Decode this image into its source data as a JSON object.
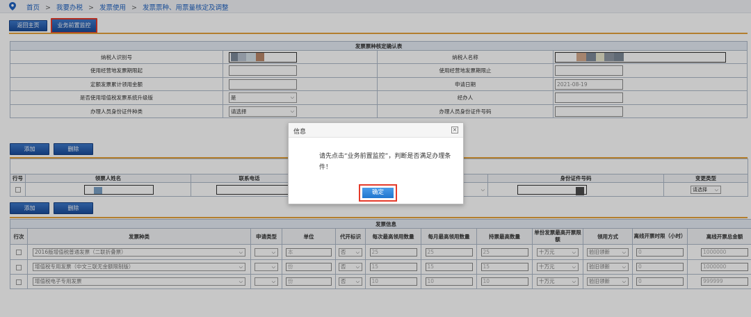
{
  "breadcrumb": {
    "items": [
      "首页",
      "我要办税",
      "发票使用",
      "发票票种、用票量核定及调整"
    ],
    "separator": ">"
  },
  "toolbar": {
    "back_label": "返回主页",
    "precheck_label": "业务前置监控"
  },
  "confirm_table": {
    "title": "发票票种核定确认表",
    "rows": [
      {
        "left_label": "纳税人识别号",
        "right_label": "纳税人名称"
      },
      {
        "left_label": "使用经营地发票期限起",
        "right_label": "使用经营地发票期限止"
      },
      {
        "left_label": "定额发票累计领用金额",
        "right_label": "申请日期",
        "right_value": "2021-08-19"
      },
      {
        "left_label": "是否使用增值税发票系统升级版",
        "left_value": "是",
        "right_label": "经办人"
      },
      {
        "left_label": "办理人员身份证件种类",
        "left_value": "请选择",
        "right_label": "办理人员身份证件号码"
      }
    ]
  },
  "ticket_section": {
    "add_label": "添加",
    "delete_label": "删除",
    "columns": [
      "行号",
      "领票人姓名",
      "联系电话",
      "身份证件号码",
      "变更类型"
    ],
    "change_type_value": "请选择"
  },
  "invoice_section": {
    "add_label": "添加",
    "delete_label": "删除",
    "title": "发票信息",
    "columns": [
      "行次",
      "发票种类",
      "申请类型",
      "单位",
      "代开标识",
      "每次最高领用数量",
      "每月最高领用数量",
      "持票最高数量",
      "单份发票最高开票限额",
      "领用方式",
      "离线开票时限（小时）",
      "离线开票总金额"
    ],
    "rows": [
      {
        "type": "2016版增值税普通发票（二联折叠票）",
        "unit": "本",
        "flag": "否",
        "per_time": "25",
        "per_month": "25",
        "max_hold": "25",
        "limit": "十万元",
        "method": "验旧领新",
        "offline_hours": "0",
        "offline_total": "1000000"
      },
      {
        "type": "增值税专用发票（中文三联无金额限制版）",
        "unit": "份",
        "flag": "否",
        "per_time": "15",
        "per_month": "15",
        "max_hold": "15",
        "limit": "十万元",
        "method": "验旧领新",
        "offline_hours": "0",
        "offline_total": "1000000"
      },
      {
        "type": "增值税电子专用发票",
        "unit": "份",
        "flag": "否",
        "per_time": "10",
        "per_month": "10",
        "max_hold": "10",
        "limit": "十万元",
        "method": "验旧领新",
        "offline_hours": "0",
        "offline_total": "999999"
      }
    ]
  },
  "dialog": {
    "title": "信息",
    "close_glyph": "×",
    "message": "请先点击“业务前置监控”，判断是否满足办理条件！",
    "ok_label": "确定"
  },
  "colors": {
    "accent_blue": "#1f62c0",
    "button_blue": "#1a4d9c",
    "highlight_red": "#e53a2a",
    "divider_orange": "#e6a23a"
  }
}
